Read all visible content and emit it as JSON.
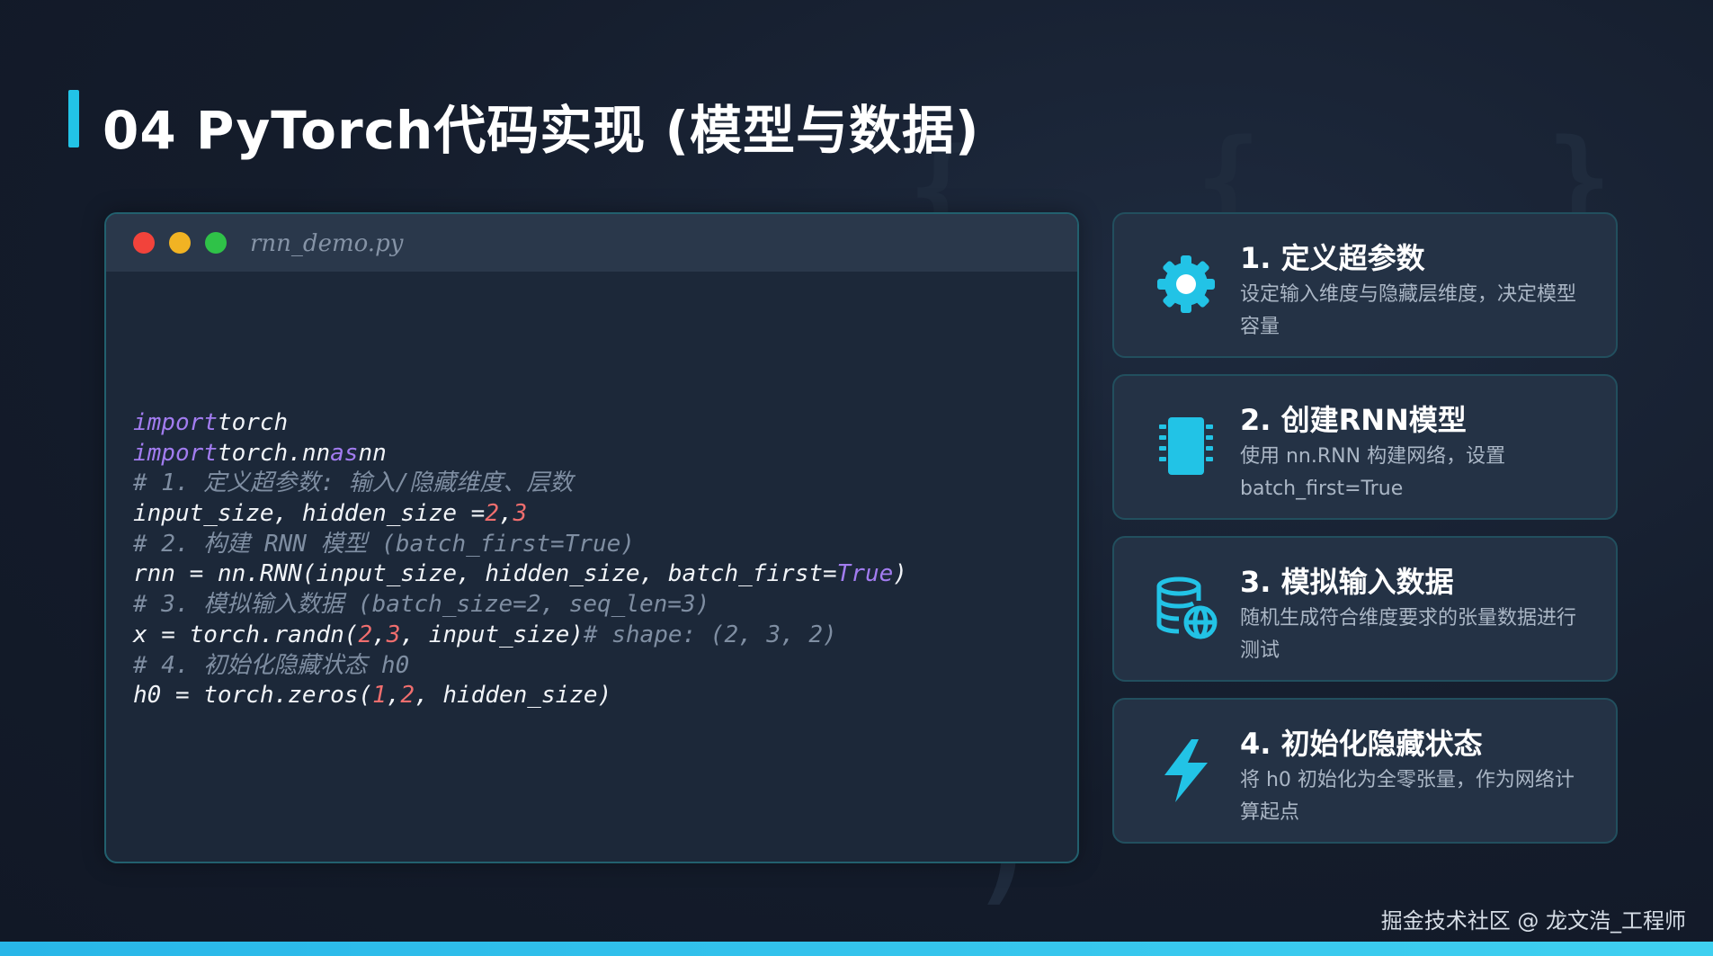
{
  "slide": {
    "title": "04 PyTorch代码实现 (模型与数据)"
  },
  "code_window": {
    "filename": "rnn_demo.py",
    "lines": [
      [
        {
          "t": "import",
          "c": "kw"
        },
        {
          "t": "torch",
          "c": "tx"
        }
      ],
      [
        {
          "t": "import",
          "c": "kw"
        },
        {
          "t": "torch.nn",
          "c": "tx"
        },
        {
          "t": "as",
          "c": "kw"
        },
        {
          "t": "nn",
          "c": "tx"
        }
      ],
      [
        {
          "t": "# 1. 定义超参数: 输入/隐藏维度、层数",
          "c": "cm"
        }
      ],
      [
        {
          "t": "input_size, hidden_size =",
          "c": "tx"
        },
        {
          "t": "2",
          "c": "num"
        },
        {
          "t": ",",
          "c": "tx"
        },
        {
          "t": "3",
          "c": "num"
        }
      ],
      [
        {
          "t": "# 2. 构建 RNN 模型 (batch_first=True)",
          "c": "cm"
        }
      ],
      [
        {
          "t": "rnn = nn.RNN(input_size, hidden_size, batch_first=",
          "c": "tx"
        },
        {
          "t": "True",
          "c": "bool"
        },
        {
          "t": ")",
          "c": "tx"
        }
      ],
      [
        {
          "t": "# 3. 模拟输入数据 (batch_size=2, seq_len=3)",
          "c": "cm"
        }
      ],
      [
        {
          "t": "x = torch.randn(",
          "c": "tx"
        },
        {
          "t": "2",
          "c": "num"
        },
        {
          "t": ",",
          "c": "tx"
        },
        {
          "t": "3",
          "c": "num"
        },
        {
          "t": ", input_size)",
          "c": "tx"
        },
        {
          "t": "# shape: (2, 3, 2)",
          "c": "cm"
        }
      ],
      [
        {
          "t": "# 4. 初始化隐藏状态 h0",
          "c": "cm"
        }
      ],
      [
        {
          "t": "h0 = torch.zeros(",
          "c": "tx"
        },
        {
          "t": "1",
          "c": "num"
        },
        {
          "t": ",",
          "c": "tx"
        },
        {
          "t": "2",
          "c": "num"
        },
        {
          "t": ", hidden_size)",
          "c": "tx"
        }
      ]
    ]
  },
  "cards": [
    {
      "title": "1. 定义超参数",
      "desc": "设定输入维度与隐藏层维度，决定模型容量",
      "icon": "gear-icon"
    },
    {
      "title": "2. 创建RNN模型",
      "desc": "使用 nn.RNN 构建网络，设置 batch_first=True",
      "icon": "chip-icon"
    },
    {
      "title": "3. 模拟输入数据",
      "desc": "随机生成符合维度要求的张量数据进行测试",
      "icon": "database-globe-icon"
    },
    {
      "title": "4. 初始化隐藏状态",
      "desc": "将 h0 初始化为全零张量，作为网络计算起点",
      "icon": "lightning-icon"
    }
  ],
  "watermark": "掘金技术社区 @ 龙文浩_工程师",
  "colors": {
    "accent": "#22c3e6",
    "keyword": "#a27cf0",
    "number": "#f06e6e",
    "comment": "#7f8ea2"
  }
}
